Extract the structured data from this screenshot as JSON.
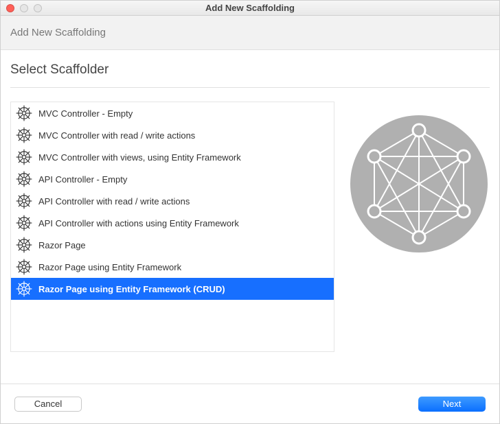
{
  "window": {
    "title": "Add New Scaffolding"
  },
  "header": {
    "title": "Add New Scaffolding"
  },
  "subheader": {
    "title": "Select Scaffolder"
  },
  "items": [
    {
      "label": "MVC Controller - Empty",
      "selected": false
    },
    {
      "label": "MVC Controller with read / write actions",
      "selected": false
    },
    {
      "label": "MVC Controller with views, using Entity Framework",
      "selected": false
    },
    {
      "label": "API Controller - Empty",
      "selected": false
    },
    {
      "label": "API Controller with read / write actions",
      "selected": false
    },
    {
      "label": "API Controller with actions using Entity Framework",
      "selected": false
    },
    {
      "label": "Razor Page",
      "selected": false
    },
    {
      "label": "Razor Page using Entity Framework",
      "selected": false
    },
    {
      "label": "Razor Page using Entity Framework (CRUD)",
      "selected": true
    }
  ],
  "footer": {
    "cancel_label": "Cancel",
    "next_label": "Next"
  }
}
